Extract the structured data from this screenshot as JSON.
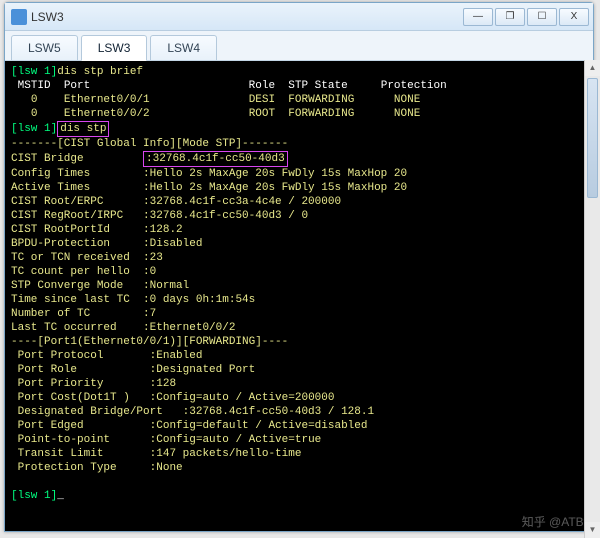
{
  "window": {
    "title": "LSW3",
    "buttons": {
      "min": "—",
      "restore": "❐",
      "max": "☐",
      "close": "X"
    }
  },
  "tabs": [
    {
      "label": "LSW5",
      "active": false
    },
    {
      "label": "LSW3",
      "active": true
    },
    {
      "label": "LSW4",
      "active": false
    }
  ],
  "terminal": {
    "prompt1_open": "[lsw 1]",
    "cmd1": "dis stp brief",
    "header": {
      "mstid": "MSTID",
      "port": "Port",
      "role": "Role",
      "state": "STP State",
      "protection": "Protection"
    },
    "rows": [
      {
        "mstid": "0",
        "port": "Ethernet0/0/1",
        "role": "DESI",
        "state": "FORWARDING",
        "prot": "NONE"
      },
      {
        "mstid": "0",
        "port": "Ethernet0/0/2",
        "role": "ROOT",
        "state": "FORWARDING",
        "prot": "NONE"
      }
    ],
    "prompt2_open": "[lsw 1]",
    "cmd2": "dis stp",
    "global_header": "-------[CIST Global Info][Mode STP]-------",
    "bridge_label": "CIST Bridge",
    "bridge_value": ":32768.4c1f-cc50-40d3",
    "lines": [
      {
        "k": "Config Times",
        "v": ":Hello 2s MaxAge 20s FwDly 15s MaxHop 20"
      },
      {
        "k": "Active Times",
        "v": ":Hello 2s MaxAge 20s FwDly 15s MaxHop 20"
      },
      {
        "k": "CIST Root/ERPC",
        "v": ":32768.4c1f-cc3a-4c4e / 200000"
      },
      {
        "k": "CIST RegRoot/IRPC",
        "v": ":32768.4c1f-cc50-40d3 / 0"
      },
      {
        "k": "CIST RootPortId",
        "v": ":128.2"
      },
      {
        "k": "BPDU-Protection",
        "v": ":Disabled"
      },
      {
        "k": "TC or TCN received",
        "v": ":23"
      },
      {
        "k": "TC count per hello",
        "v": ":0"
      },
      {
        "k": "STP Converge Mode",
        "v": ":Normal"
      },
      {
        "k": "Time since last TC",
        "v": ":0 days 0h:1m:54s"
      },
      {
        "k": "Number of TC",
        "v": ":7"
      },
      {
        "k": "Last TC occurred",
        "v": ":Ethernet0/0/2"
      }
    ],
    "port_header": "----[Port1(Ethernet0/0/1)][FORWARDING]----",
    "port_lines": [
      {
        "k": " Port Protocol",
        "v": ":Enabled"
      },
      {
        "k": " Port Role",
        "v": ":Designated Port"
      },
      {
        "k": " Port Priority",
        "v": ":128"
      },
      {
        "k": " Port Cost(Dot1T )",
        "v": ":Config=auto / Active=200000"
      },
      {
        "k": " Designated Bridge/Port",
        "v": ":32768.4c1f-cc50-40d3 / 128.1"
      },
      {
        "k": " Port Edged",
        "v": ":Config=default / Active=disabled"
      },
      {
        "k": " Point-to-point",
        "v": ":Config=auto / Active=true"
      },
      {
        "k": " Transit Limit",
        "v": ":147 packets/hello-time"
      },
      {
        "k": " Protection Type",
        "v": ":None"
      }
    ],
    "prompt3": "[lsw 1]",
    "cursor": "_"
  },
  "watermark": "知乎 @ATBf"
}
